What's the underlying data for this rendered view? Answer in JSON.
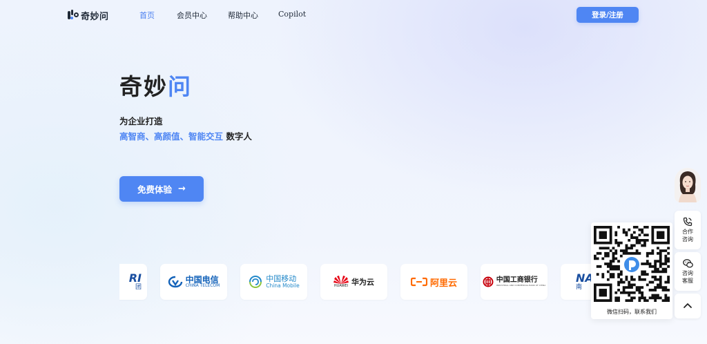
{
  "nav": {
    "logo_text": "奇妙问",
    "links": [
      "首页",
      "会员中心",
      "帮助中心",
      "Copilot"
    ],
    "active_index": 0,
    "login_label": "登录/注册"
  },
  "hero": {
    "title_main": "奇妙",
    "title_accent": "问",
    "subtitle_line1": "为企业打造",
    "subtitle_accent": "高智商、高颜值、智能交互",
    "subtitle_rest": " 数字人",
    "cta_label": "免费体验",
    "cta_arrow": "→"
  },
  "partners": [
    {
      "name": "nari-partial",
      "text": "RI",
      "sub": "团",
      "color": "#1a4fa0"
    },
    {
      "name": "china-telecom",
      "text": "中国电信",
      "sub": "CHINA TELECOM",
      "color": "#1362b9"
    },
    {
      "name": "china-mobile",
      "text": "中国移动",
      "sub": "China Mobile",
      "color": "#2288c9"
    },
    {
      "name": "huawei-cloud",
      "text": "华为云",
      "sub": "HUAWEI",
      "color": "#222222"
    },
    {
      "name": "aliyun",
      "text": "阿里云",
      "sub": "",
      "color": "#ff6a00"
    },
    {
      "name": "icbc",
      "text": "中国工商银行",
      "sub": "INDUSTRIAL AND COMMERCIAL BANK OF CHINA",
      "color": "#222222"
    },
    {
      "name": "nari",
      "text": "NA",
      "sub": "南",
      "color": "#1a4fa0"
    }
  ],
  "sidebar": {
    "cooperate_label": "合作咨询",
    "service_label": "咨询客服"
  },
  "qr": {
    "caption": "微信扫码，联系我们"
  },
  "colors": {
    "accent": "#4f86f3",
    "text": "#222222"
  }
}
